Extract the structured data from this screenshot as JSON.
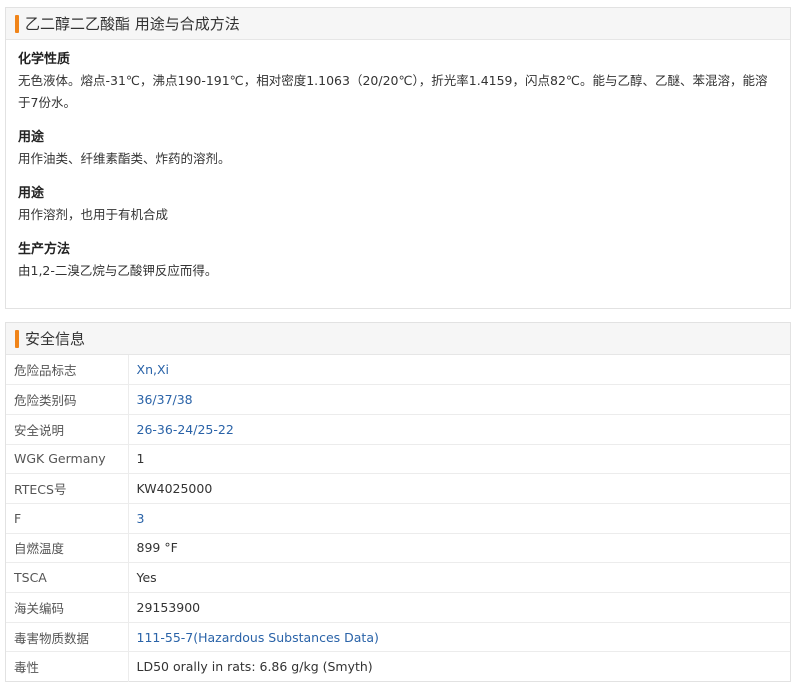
{
  "usage_panel": {
    "title": "乙二醇二乙酸酯 用途与合成方法",
    "sections": [
      {
        "heading": "化学性质",
        "text": "无色液体。熔点-31℃，沸点190-191℃，相对密度1.1063（20/20℃），折光率1.4159，闪点82℃。能与乙醇、乙醚、苯混溶，能溶于7份水。"
      },
      {
        "heading": "用途",
        "text": "用作油类、纤维素酯类、炸药的溶剂。"
      },
      {
        "heading": "用途",
        "text": "用作溶剂，也用于有机合成"
      },
      {
        "heading": "生产方法",
        "text": "由1,2-二溴乙烷与乙酸钾反应而得。"
      }
    ]
  },
  "safety_panel": {
    "title": "安全信息",
    "rows": [
      {
        "key": "危险品标志",
        "value": "Xn,Xi",
        "link": true
      },
      {
        "key": "危险类别码",
        "value": "36/37/38",
        "link": true
      },
      {
        "key": "安全说明",
        "value": "26-36-24/25-22",
        "link": true
      },
      {
        "key": "WGK Germany",
        "value": "1",
        "link": false
      },
      {
        "key": "RTECS号",
        "value": "KW4025000",
        "link": false
      },
      {
        "key": "F",
        "value": "3",
        "link": true
      },
      {
        "key": "自燃温度",
        "value": "899 °F",
        "link": false
      },
      {
        "key": "TSCA",
        "value": "Yes",
        "link": false
      },
      {
        "key": "海关编码",
        "value": "29153900",
        "link": false
      },
      {
        "key": "毒害物质数据",
        "value": "111-55-7(Hazardous Substances Data)",
        "link": true
      },
      {
        "key": "毒性",
        "value": "LD50 orally in rats: 6.86 g/kg (Smyth)",
        "link": false
      }
    ]
  },
  "colors": {
    "accent": "#f08419",
    "link": "#2a63a8",
    "header_bg": "#f6f6f6"
  }
}
